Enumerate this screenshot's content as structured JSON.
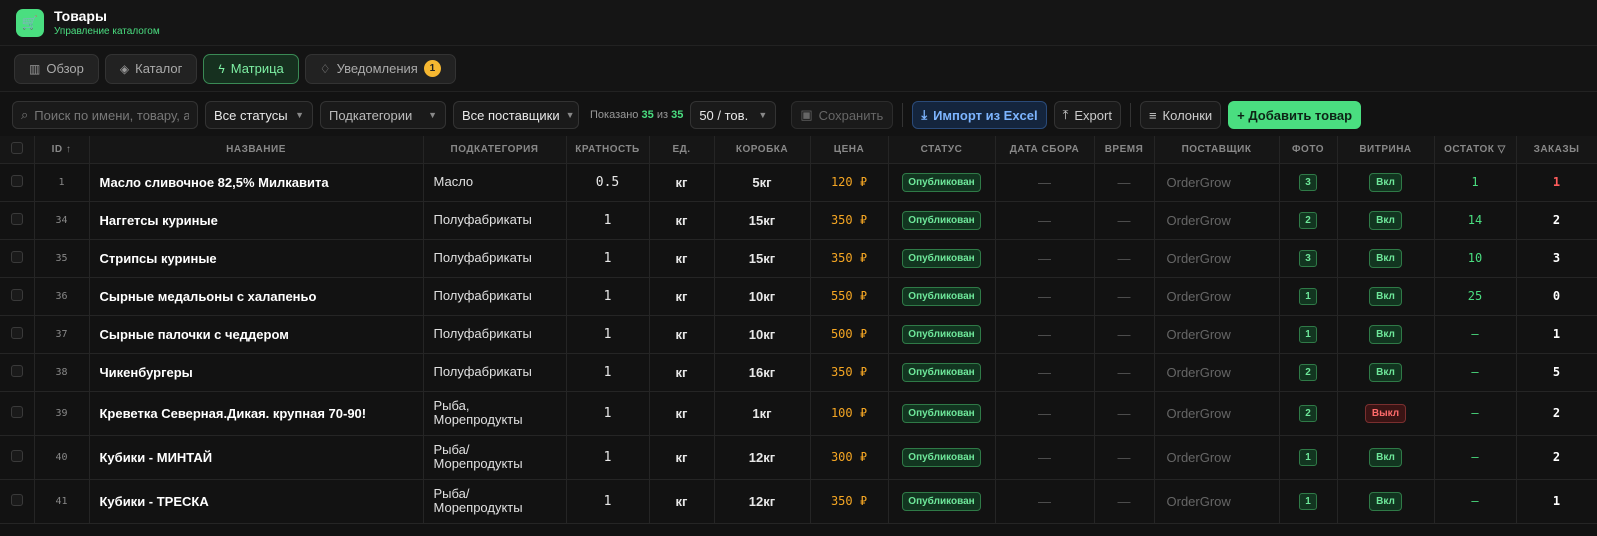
{
  "header": {
    "icon": "cart-icon",
    "title": "Товары",
    "subtitle": "Управление каталогом"
  },
  "tabs": [
    {
      "label": "Обзор",
      "icon": "chart-icon"
    },
    {
      "label": "Каталог",
      "icon": "box-icon"
    },
    {
      "label": "Матрица",
      "icon": "bolt-icon",
      "active": true
    },
    {
      "label": "Уведомления",
      "icon": "bell-icon",
      "badge": "1"
    }
  ],
  "toolbar": {
    "search_placeholder": "Поиск по имени, товару, а",
    "status": "Все статусы",
    "subcategory": "Подкатегории",
    "supplier": "Все поставщики",
    "shown_prefix": "Показано",
    "shown_count": "35",
    "shown_mid": "из",
    "shown_total": "35",
    "per_page": "50 / тов.",
    "save": "Сохранить",
    "import": "Импорт из Excel",
    "export": "Export",
    "columns": "Колонки",
    "add": "+ Добавить товар"
  },
  "table": {
    "columns": [
      "ID ↑",
      "НАЗВАНИЕ",
      "ПОДКАТЕГОРИЯ",
      "КРАТНОСТЬ",
      "ЕД.",
      "КОРОБКА",
      "ЦЕНА",
      "СТАТУС",
      "ДАТА СБОРА",
      "ВРЕМЯ",
      "ПОСТАВЩИК",
      "ФОТО",
      "ВИТРИНА",
      "ОСТАТОК",
      "ЗАКАЗЫ"
    ],
    "rows": [
      {
        "id": "1",
        "name": "Масло сливочное 82,5% Милкавита",
        "sub": "Масло",
        "mult": "0.5",
        "unit": "кг",
        "box": "5кг",
        "price": "120 ₽",
        "status": "Опубликован",
        "date": "—",
        "time": "—",
        "supplier": "OrderGrow",
        "photo": "3",
        "vitrina": "Вкл",
        "stock": "1",
        "orders": "1"
      },
      {
        "id": "34",
        "name": "Наггетсы куриные",
        "sub": "Полуфабрикаты",
        "mult": "1",
        "unit": "кг",
        "box": "15кг",
        "price": "350 ₽",
        "status": "Опубликован",
        "date": "—",
        "time": "—",
        "supplier": "OrderGrow",
        "photo": "2",
        "vitrina": "Вкл",
        "stock": "14",
        "orders": "2"
      },
      {
        "id": "35",
        "name": "Стрипсы куриные",
        "sub": "Полуфабрикаты",
        "mult": "1",
        "unit": "кг",
        "box": "15кг",
        "price": "350 ₽",
        "status": "Опубликован",
        "date": "—",
        "time": "—",
        "supplier": "OrderGrow",
        "photo": "3",
        "vitrina": "Вкл",
        "stock": "10",
        "orders": "3"
      },
      {
        "id": "36",
        "name": "Сырные медальоны с халапеньо",
        "sub": "Полуфабрикаты",
        "mult": "1",
        "unit": "кг",
        "box": "10кг",
        "price": "550 ₽",
        "status": "Опубликован",
        "date": "—",
        "time": "—",
        "supplier": "OrderGrow",
        "photo": "1",
        "vitrina": "Вкл",
        "stock": "25",
        "orders": "0"
      },
      {
        "id": "37",
        "name": "Сырные палочки с чеддером",
        "sub": "Полуфабрикаты",
        "mult": "1",
        "unit": "кг",
        "box": "10кг",
        "price": "500 ₽",
        "status": "Опубликован",
        "date": "—",
        "time": "—",
        "supplier": "OrderGrow",
        "photo": "1",
        "vitrina": "Вкл",
        "stock": "—",
        "orders": "1"
      },
      {
        "id": "38",
        "name": "Чикенбургеры",
        "sub": "Полуфабрикаты",
        "mult": "1",
        "unit": "кг",
        "box": "16кг",
        "price": "350 ₽",
        "status": "Опубликован",
        "date": "—",
        "time": "—",
        "supplier": "OrderGrow",
        "photo": "2",
        "vitrina": "Вкл",
        "stock": "—",
        "orders": "5"
      },
      {
        "id": "39",
        "name": "Креветка Северная.Дикая. крупная 70-90!",
        "sub": "Рыба, Морепродукты",
        "mult": "1",
        "unit": "кг",
        "box": "1кг",
        "price": "100 ₽",
        "status": "Опубликован",
        "date": "—",
        "time": "—",
        "supplier": "OrderGrow",
        "photo": "2",
        "vitrina": "Выкл",
        "stock": "—",
        "orders": "2"
      },
      {
        "id": "40",
        "name": "Кубики - МИНТАЙ",
        "sub": "Рыба/ Морепродукты",
        "mult": "1",
        "unit": "кг",
        "box": "12кг",
        "price": "300 ₽",
        "status": "Опубликован",
        "date": "—",
        "time": "—",
        "supplier": "OrderGrow",
        "photo": "1",
        "vitrina": "Вкл",
        "stock": "—",
        "orders": "2"
      },
      {
        "id": "41",
        "name": "Кубики - ТРЕСКА",
        "sub": "Рыба/ Морепродукты",
        "mult": "1",
        "unit": "кг",
        "box": "12кг",
        "price": "350 ₽",
        "status": "Опубликован",
        "date": "—",
        "time": "—",
        "supplier": "OrderGrow",
        "photo": "1",
        "vitrina": "Вкл",
        "stock": "—",
        "orders": "1"
      }
    ]
  }
}
